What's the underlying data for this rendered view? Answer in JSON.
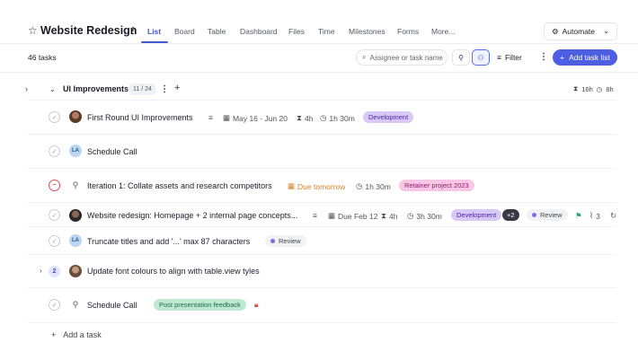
{
  "header": {
    "title": "Website Redesign",
    "tabs": [
      {
        "label": "List",
        "active": true
      },
      {
        "label": "Board"
      },
      {
        "label": "Table"
      },
      {
        "label": "Dashboard"
      },
      {
        "label": "Files"
      },
      {
        "label": "Time"
      },
      {
        "label": "Milestones"
      },
      {
        "label": "Forms"
      },
      {
        "label": "More..."
      }
    ],
    "automate_label": "Automate"
  },
  "toolbar": {
    "task_count": "46 tasks",
    "search_placeholder": "Assignee or task name",
    "filter_label": "Filter",
    "add_list_label": "Add task list"
  },
  "group": {
    "title": "UI Improvements",
    "count": "11 / 24",
    "time_logged": "16h",
    "time_estimated": "8h"
  },
  "tasks": [
    {
      "name": "First Round UI Improvements",
      "dates": "May 16 - Jun 20",
      "estimate": "4h",
      "logged": "1h 30m",
      "tag": "Development"
    },
    {
      "name": "Schedule Call",
      "initials": "LA"
    },
    {
      "name": "Iteration 1: Collate assets and research competitors",
      "due": "Due tomorrow",
      "logged": "1h 30m",
      "tag": "Retainer project 2023"
    },
    {
      "name": "Website redesign: Homepage + 2 internal page concepts...",
      "due": "Due Feb 12",
      "estimate": "4h",
      "logged": "3h 30m",
      "tag": "Development",
      "extra_tags": "+2",
      "status": "Review",
      "attachments": "3"
    },
    {
      "name": "Truncate titles and add '...' max 87 characters",
      "initials": "LA",
      "status": "Review"
    },
    {
      "name": "Update font colours to align with table.view tyles",
      "subtasks": "2"
    },
    {
      "name": "Schedule Call",
      "tag": "Post presentation feedback"
    }
  ],
  "add_task_label": "Add a task",
  "colors": {
    "accent": "#4d5fe0",
    "development": "#d7c8f6",
    "retainer": "#f7c7e5",
    "post": "#bfe8d2",
    "due_soon": "#d9822b"
  }
}
